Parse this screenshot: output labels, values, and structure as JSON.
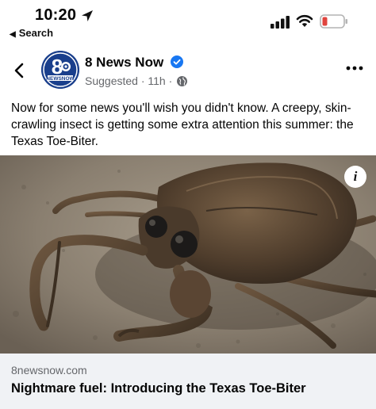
{
  "status_bar": {
    "time": "10:20",
    "back_label": "Search",
    "battery_color": "#e0443e"
  },
  "post": {
    "page_name": "8 News Now",
    "verified": true,
    "meta": "Suggested · 11h ·",
    "avatar_label": "NEWSNOW",
    "avatar_number": "8",
    "text": "Now for some news you'll wish you didn't know. A creepy, skin-crawling insect is getting some extra attention this summer: the Texas Toe-Biter.",
    "info_icon": "i"
  },
  "link_preview": {
    "domain": "8newsnow.com",
    "title": "Nightmare fuel: Introducing the Texas Toe-Biter"
  },
  "colors": {
    "verified_blue": "#1877f2",
    "secondary_text": "#65676b",
    "card_bg": "#f0f2f5",
    "avatar_blue": "#1a3f8c"
  }
}
